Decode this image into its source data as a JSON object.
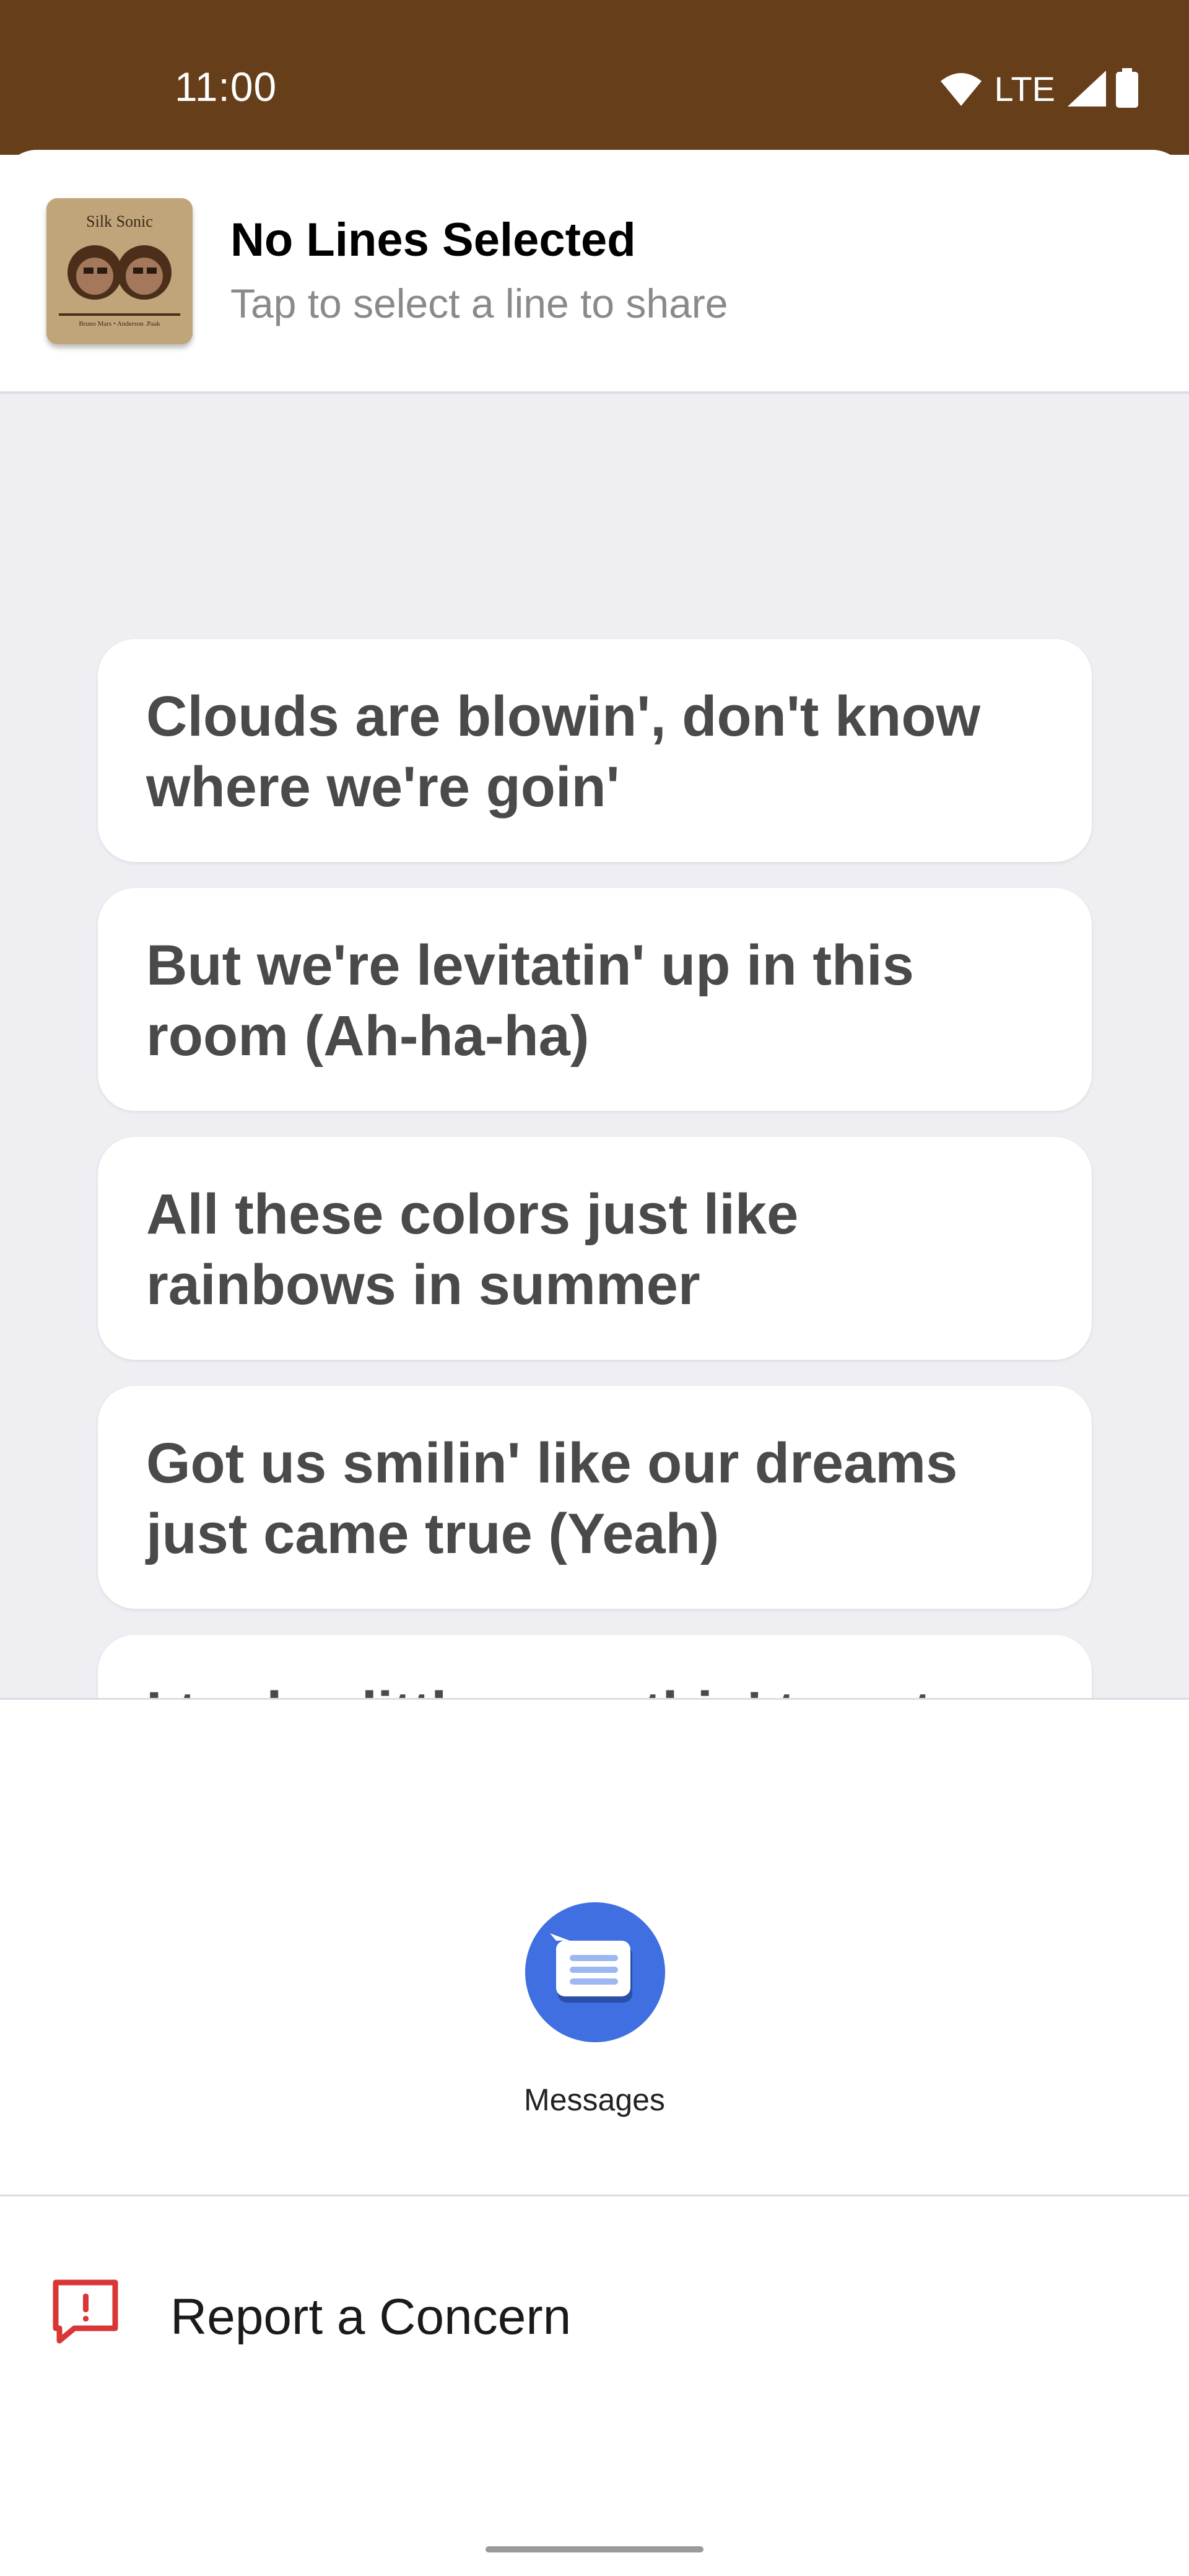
{
  "status_bar": {
    "time": "11:00",
    "network": "LTE",
    "background_color": "#663f1a",
    "icons": [
      "wifi-icon",
      "cell-signal-icon",
      "battery-icon"
    ]
  },
  "header": {
    "title": "No Lines Selected",
    "subtitle": "Tap to select a line to share",
    "album_art": {
      "artist_text": "Silk Sonic",
      "fine_print": "Bruno Mars • Anderson .Paak"
    }
  },
  "lyrics": [
    "Clouds are blowin', don't know where we're goin'",
    "But we're levitatin' up in this room (Ah-ha-ha)",
    "All these colors just like rainbows in summer",
    "Got us smilin' like our dreams just came true (Yeah)",
    "I took a little somethin' to get here, yeah, yeah"
  ],
  "share_targets": [
    {
      "label": "Messages",
      "icon": "messages-icon",
      "color": "#3f6fe0"
    }
  ],
  "footer": {
    "report_label": "Report a Concern",
    "report_icon": "report-flag-icon",
    "accent_color": "#d93636"
  }
}
